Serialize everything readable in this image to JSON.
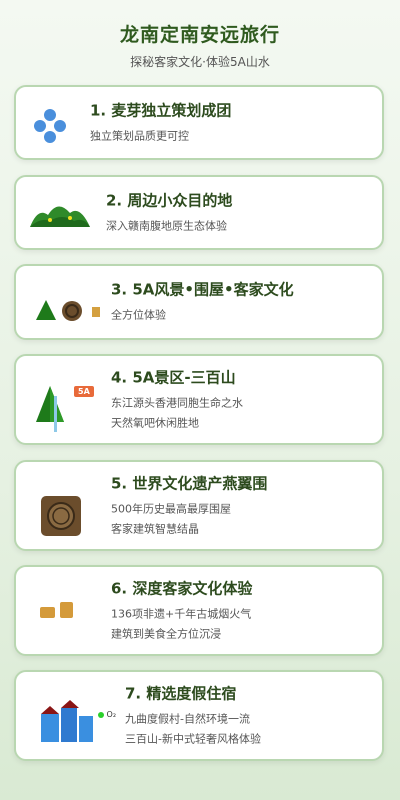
{
  "header": {
    "title": "龙南定南安远旅行",
    "subtitle": "探秘客家文化·体验5A山水"
  },
  "cards": [
    {
      "title": "1. 麦芽独立策划成团",
      "lines": [
        "独立策划品质更可控"
      ],
      "icon": "flower-dots-icon"
    },
    {
      "title": "2. 周边小众目的地",
      "lines": [
        "深入赣南腹地原生态体验"
      ],
      "icon": "green-hills-icon"
    },
    {
      "title": "3. 5A风景•围屋•客家文化",
      "lines": [
        "全方位体验"
      ],
      "icon": "tree-roundhouse-icon"
    },
    {
      "title": "4. 5A景区-三百山",
      "lines": [
        "东江源头香港同胞生命之水",
        "天然氧吧休闲胜地"
      ],
      "icon": "mountain-waterfall-icon",
      "badge": "5A"
    },
    {
      "title": "5. 世界文化遗产燕翼围",
      "lines": [
        "500年历史最高最厚围屋",
        "客家建筑智慧结晶"
      ],
      "icon": "roundhouse-icon"
    },
    {
      "title": "6. 深度客家文化体验",
      "lines": [
        "136项非遗+千年古城烟火气",
        "建筑到美食全方位沉浸"
      ],
      "icon": "culture-blocks-icon"
    },
    {
      "title": "7. 精选度假住宿",
      "lines": [
        "九曲度假村-自然环境一流",
        "三百山-新中式轻奢风格体验"
      ],
      "icon": "resort-buildings-icon",
      "o2": "O₂"
    }
  ]
}
